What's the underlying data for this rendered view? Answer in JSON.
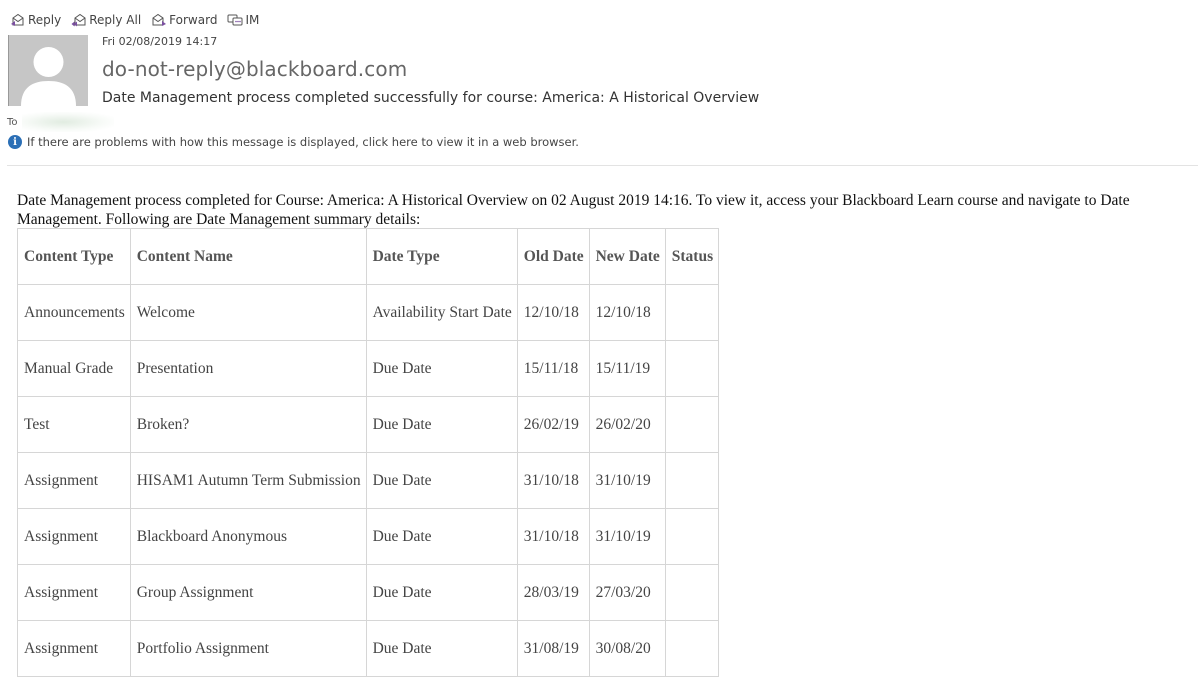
{
  "toolbar": {
    "reply": "Reply",
    "reply_all": "Reply All",
    "forward": "Forward",
    "im": "IM"
  },
  "header": {
    "sent_time": "Fri 02/08/2019 14:17",
    "sender": "do-not-reply@blackboard.com",
    "subject": "Date Management process completed successfully for course: America: A Historical Overview",
    "to_label": "To",
    "info_text": "If there are problems with how this message is displayed, click here to view it in a web browser."
  },
  "body": {
    "intro": "Date Management process completed for Course: America: A Historical Overview on 02 August 2019 14:16. To view it, access your Blackboard Learn course and navigate to Date Management. Following are Date Management summary details:",
    "table": {
      "headers": [
        "Content Type",
        "Content Name",
        "Date Type",
        "Old Date",
        "New Date",
        "Status"
      ],
      "rows": [
        [
          "Announcements",
          "Welcome",
          "Availability Start Date",
          "12/10/18",
          "12/10/18",
          ""
        ],
        [
          "Manual Grade",
          "Presentation",
          "Due Date",
          "15/11/18",
          "15/11/19",
          ""
        ],
        [
          "Test",
          "Broken?",
          "Due Date",
          "26/02/19",
          "26/02/20",
          ""
        ],
        [
          "Assignment",
          "HISAM1 Autumn Term Submission",
          "Due Date",
          "31/10/18",
          "31/10/19",
          ""
        ],
        [
          "Assignment",
          "Blackboard Anonymous",
          "Due Date",
          "31/10/18",
          "31/10/19",
          ""
        ],
        [
          "Assignment",
          "Group Assignment",
          "Due Date",
          "28/03/19",
          "27/03/20",
          ""
        ],
        [
          "Assignment",
          "Portfolio Assignment",
          "Due Date",
          "31/08/19",
          "30/08/20",
          ""
        ]
      ]
    }
  },
  "colors": {
    "info_icon": "#2b6fb6",
    "avatar_bg": "#c6c6c6",
    "icon_accent": "#7a4fa0"
  }
}
